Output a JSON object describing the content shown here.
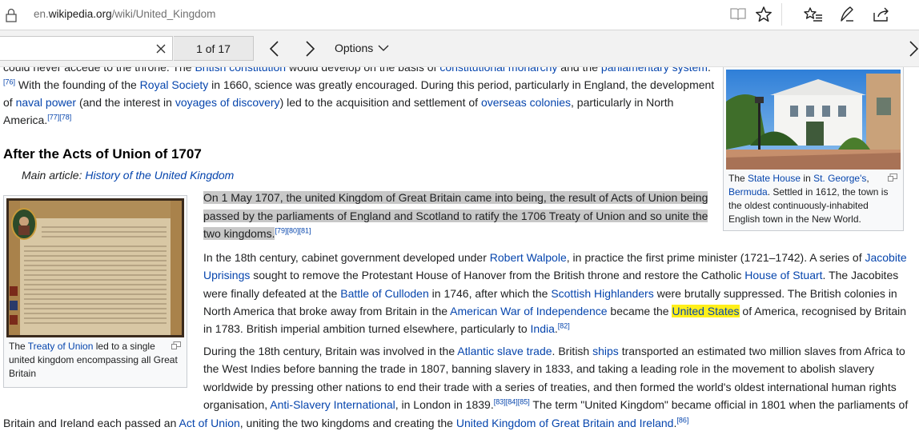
{
  "browser": {
    "url_prefix": "en.",
    "url_host": "wikipedia.org",
    "url_path": "/wiki/United_Kingdom",
    "icons": [
      "lock-icon",
      "reading-view-icon",
      "favorite-star-icon",
      "favorites-hub-icon",
      "pen-icon",
      "share-icon"
    ]
  },
  "findbar": {
    "query": "",
    "match_count": "1 of 17",
    "options_label": "Options"
  },
  "article": {
    "top": {
      "t0": "could never accede to the throne. The ",
      "l0": "British constitution",
      "t1": " would develop on the basis of ",
      "l1": "constitutional monarchy",
      "t2": " and the ",
      "l2": "parliamentary system",
      "t3": ".",
      "r1": "[76]",
      "t4": " With the founding of the ",
      "l3": "Royal Society",
      "t5": " in 1660, science was greatly encouraged. During this period, particularly in England, the development of ",
      "l4": "naval power",
      "t6": " (and the interest in ",
      "l5": "voyages of discovery",
      "t7": ") led to the acquisition and settlement of ",
      "l6": "overseas colonies",
      "t8": ", particularly in North America.",
      "r2": "[77][78]"
    },
    "section_heading": "After the Acts of Union of 1707",
    "hatnote": {
      "prefix": "Main article: ",
      "link": "History of the United Kingdom"
    },
    "union": {
      "highlight": "On 1 May 1707, the united Kingdom of Great Britain came into being, the result of Acts of Union being passed by the parliaments of England and Scotland to ratify the 1706 Treaty of Union and so unite the two kingdoms.",
      "refs": "[79][80][81]"
    },
    "p18": {
      "t0": "In the 18th century, cabinet government developed under ",
      "l0": "Robert Walpole",
      "t1": ", in practice the first prime minister (1721–1742). A series of ",
      "l1": "Jacobite Uprisings",
      "t2": " sought to remove the Protestant ",
      "l2": "House of Hanover",
      "t3": " from the British throne and restore the Catholic ",
      "l3": "House of Stuart",
      "t4": ". The Jacobites were finally defeated at the ",
      "l4": "Battle of Culloden",
      "t5": " in 1746, after which the ",
      "l5": "Scottish Highlanders",
      "t6": " were brutally suppressed. The British colonies in North America that broke away from Britain in the ",
      "l6": "American War of Independence",
      "t7": " became the ",
      "hl": "United States",
      "t8": " of America, recognised by Britain in 1783. British imperial ambition turned elsewhere, particularly to ",
      "l7": "India",
      "t9": ".",
      "r1": "[82]"
    },
    "slave": {
      "t0": "During the 18th century, Britain was involved in the ",
      "l0": "Atlantic slave trade",
      "t1": ". British ",
      "l1": "ships",
      "t2": " transported an estimated two million slaves from Africa to the West Indies before banning the trade in 1807, banning slavery in 1833, and taking a leading role in the movement to abolish slavery worldwide by pressing other nations to end their trade with a series of treaties, and then formed the world's oldest international human rights organisation, ",
      "l2": "Anti-Slavery International",
      "t3": ", in London in 1839.",
      "r1": "[83][84][85]",
      "t4": " The term \"United Kingdom\" became official in 1801 when the parliaments of",
      "t5": "Britain and Ireland each passed an ",
      "l3": "Act of Union",
      "t6": ", uniting the two kingdoms and creating the ",
      "l4": "United Kingdom of Great Britain and Ireland",
      "t7": ".",
      "r2": "[86]"
    },
    "bermuda_caption": {
      "t0": "The ",
      "l0": "State House",
      "t1": " in ",
      "l1": "St. George's",
      "t2": ", ",
      "l2": "Bermuda",
      "t3": ". Settled in 1612, the town is the oldest continuously-inhabited English town in the New World."
    },
    "treaty_caption": {
      "t0": "The ",
      "l0": "Treaty of Union",
      "t1": " led to a single united kingdom encompassing all Great Britain"
    }
  },
  "colors": {
    "link": "#0645ad",
    "find_highlight_current": "#c8c8c8",
    "find_highlight_match": "#ffef1a"
  }
}
